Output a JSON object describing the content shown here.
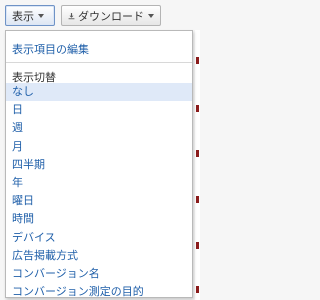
{
  "toolbar": {
    "view_label": "表示",
    "download_label": "ダウンロード"
  },
  "menu": {
    "edit_label": "表示項目の編集",
    "section_label": "表示切替",
    "items": [
      {
        "label": "なし",
        "selected": true
      },
      {
        "label": "日",
        "selected": false
      },
      {
        "label": "週",
        "selected": false
      },
      {
        "label": "月",
        "selected": false
      },
      {
        "label": "四半期",
        "selected": false
      },
      {
        "label": "年",
        "selected": false
      },
      {
        "label": "曜日",
        "selected": false
      },
      {
        "label": "時間",
        "selected": false
      },
      {
        "label": "デバイス",
        "selected": false
      },
      {
        "label": "広告掲載方式",
        "selected": false
      },
      {
        "label": "コンバージョン名",
        "selected": false
      },
      {
        "label": "コンバージョン測定の目的",
        "selected": false
      }
    ]
  },
  "icons": {
    "download": "download-icon",
    "caret": "caret-down-icon"
  },
  "colors": {
    "link": "#1f5fa9",
    "selected_bg": "#dfe9f8",
    "active_border": "#6f93c6"
  }
}
